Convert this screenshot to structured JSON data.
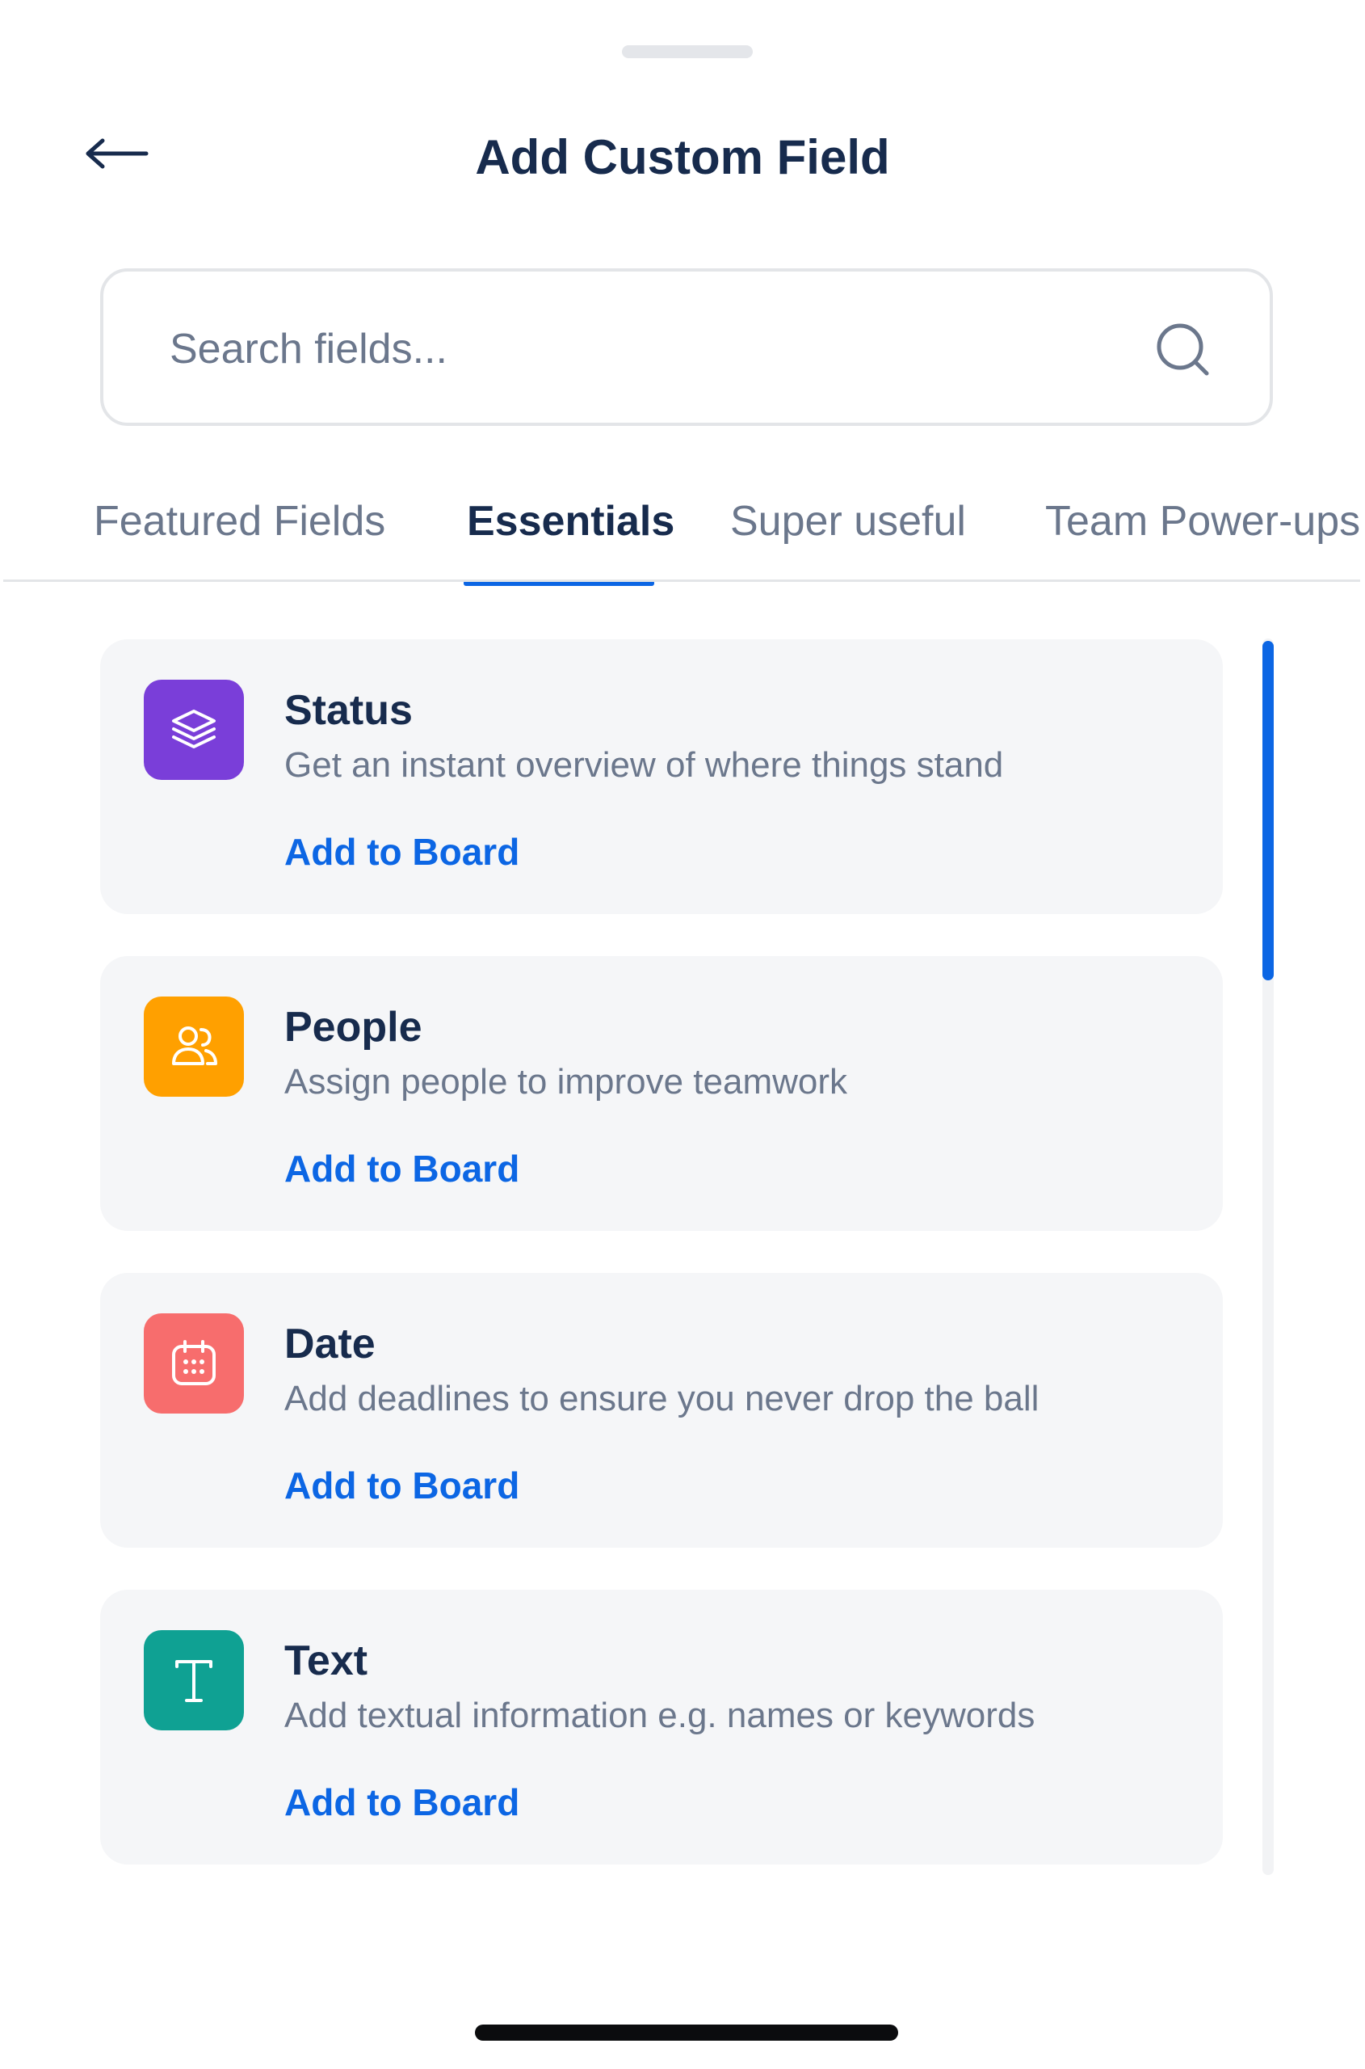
{
  "header": {
    "title": "Add Custom Field",
    "back_icon": "arrow-left-icon"
  },
  "search": {
    "placeholder": "Search fields...",
    "value": "",
    "icon": "search-icon"
  },
  "tabs": [
    {
      "label": "Featured Fields",
      "active": false
    },
    {
      "label": "Essentials",
      "active": true
    },
    {
      "label": "Super useful",
      "active": false
    },
    {
      "label": "Team Power-ups",
      "active": false
    }
  ],
  "fields": [
    {
      "title": "Status",
      "description": "Get an instant overview of where things stand",
      "action": "Add to Board",
      "icon": "layers-icon",
      "color": "#7a3ed9"
    },
    {
      "title": "People",
      "description": "Assign people to improve teamwork",
      "action": "Add to Board",
      "icon": "people-icon",
      "color": "#ffa000"
    },
    {
      "title": "Date",
      "description": "Add deadlines to ensure you never drop the ball",
      "action": "Add to Board",
      "icon": "calendar-icon",
      "color": "#f76d6d"
    },
    {
      "title": "Text",
      "description": "Add textual information e.g. names or keywords",
      "action": "Add to Board",
      "icon": "text-icon",
      "color": "#0fa193"
    }
  ],
  "colors": {
    "accent": "#0c66e4",
    "heading": "#172b4d",
    "muted": "#6b778c",
    "card_bg": "#f5f6f8"
  }
}
